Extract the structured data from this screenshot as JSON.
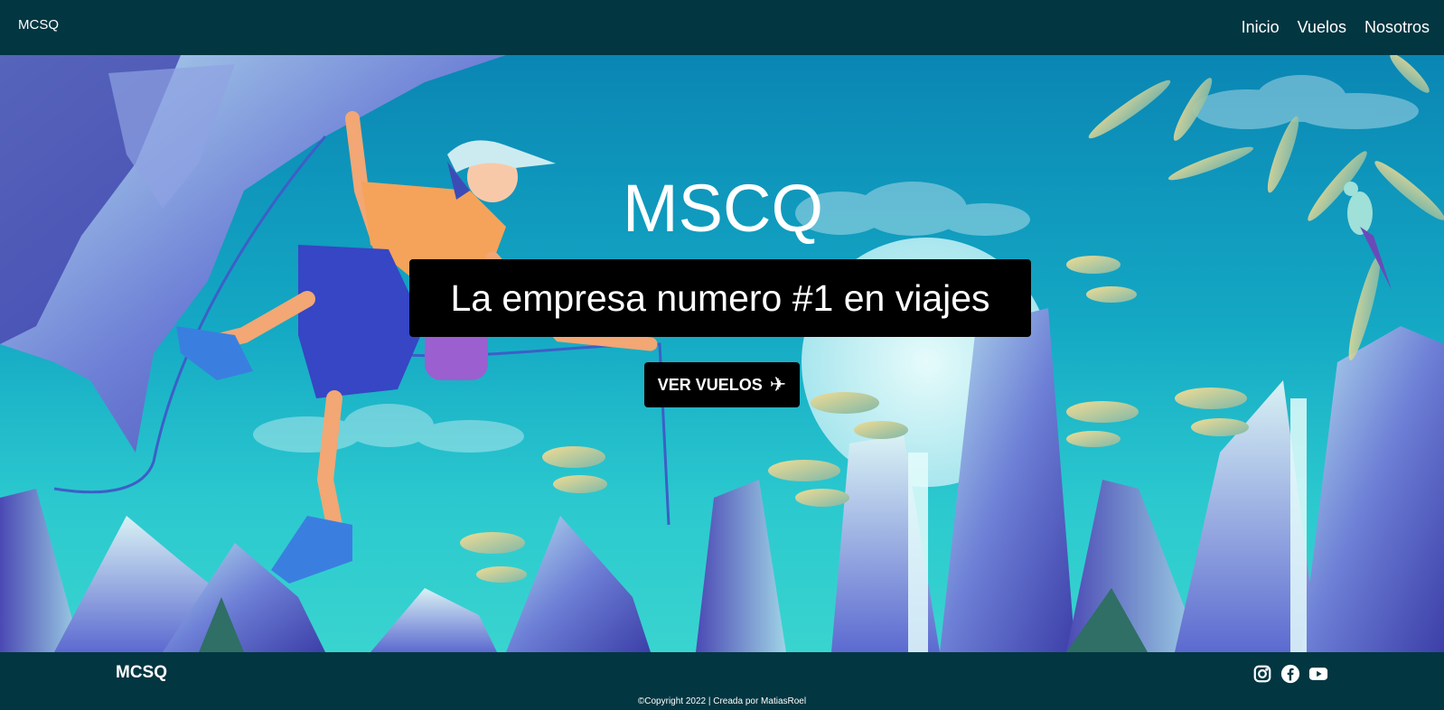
{
  "header": {
    "brand": "MCSQ",
    "nav": [
      {
        "label": "Inicio"
      },
      {
        "label": "Vuelos"
      },
      {
        "label": "Nosotros"
      }
    ]
  },
  "hero": {
    "title": "MSCQ",
    "subtitle": "La empresa numero #1 en viajes",
    "cta_label": "VER VUELOS",
    "cta_icon": "plane-icon"
  },
  "footer": {
    "brand": "MCSQ",
    "social": [
      {
        "name": "instagram-icon"
      },
      {
        "name": "facebook-icon"
      },
      {
        "name": "youtube-icon"
      }
    ],
    "copyright": "©Copyright 2022 | Creada por MatiasRoel"
  },
  "colors": {
    "navbar": "#023641",
    "sky_top": "#0a86b4",
    "sky_bottom": "#39d4cf",
    "button_bg": "#000000",
    "text": "#ffffff"
  }
}
